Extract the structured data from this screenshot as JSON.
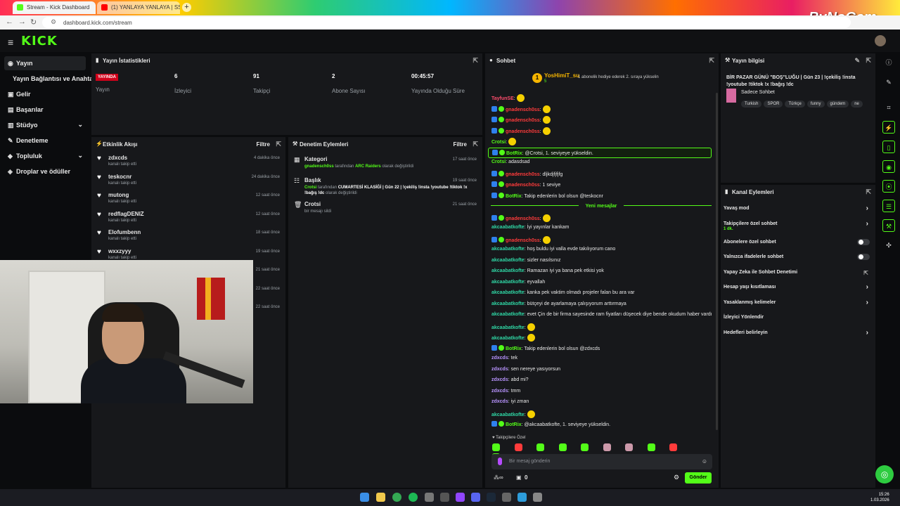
{
  "browser": {
    "tabs": [
      {
        "title": "Stream - Kick Dashboard"
      },
      {
        "title": "(1) YANLAYA YANLAYA | SS/dc"
      }
    ],
    "url": "dashboard.kick.com/stream",
    "watermark": "ByNoGam"
  },
  "brand": {
    "logo": "KICK",
    "accent": "#53fc18"
  },
  "sidebar": {
    "items": [
      {
        "label": "Yayın",
        "icon": "broadcast-icon"
      },
      {
        "label": "Yayın Bağlantısı ve Anahtarı",
        "icon": ""
      },
      {
        "label": "Gelir",
        "icon": "income-icon"
      },
      {
        "label": "Başarılar",
        "icon": "achievements-icon"
      },
      {
        "label": "Stüdyo",
        "icon": "studio-icon"
      },
      {
        "label": "Denetleme",
        "icon": "moderation-icon"
      },
      {
        "label": "Topluluk",
        "icon": "community-icon"
      },
      {
        "label": "Droplar ve ödüller",
        "icon": "drops-icon"
      }
    ]
  },
  "stats": {
    "title": "Yayın İstatistikleri",
    "live_badge": "YAYINDA",
    "items": [
      {
        "value": "",
        "label": "Yayın"
      },
      {
        "value": "6",
        "label": "İzleyici"
      },
      {
        "value": "91",
        "label": "Takipçi"
      },
      {
        "value": "2",
        "label": "Abone Sayısı"
      },
      {
        "value": "00:45:57",
        "label": "Yayında Olduğu Süre"
      }
    ]
  },
  "activity": {
    "title": "Etkinlik Akışı",
    "filter": "Filtre",
    "rows": [
      {
        "name": "zdxcds",
        "sub": "kanalı takip etti",
        "time": "4 dakika önce"
      },
      {
        "name": "teskocnr",
        "sub": "kanalı takip etti",
        "time": "24 dakika önce"
      },
      {
        "name": "mutong",
        "sub": "kanalı takip etti",
        "time": "12 saat önce"
      },
      {
        "name": "redflagDENIZ",
        "sub": "kanalı takip etti",
        "time": "12 saat önce"
      },
      {
        "name": "Elofumbenn",
        "sub": "kanalı takip etti",
        "time": "18 saat önce"
      },
      {
        "name": "wxxzyyy",
        "sub": "kanalı takip etti",
        "time": "19 saat önce"
      },
      {
        "name": "",
        "sub": "",
        "time": "21 saat önce"
      },
      {
        "name": "",
        "sub": "",
        "time": "22 saat önce"
      },
      {
        "name": "",
        "sub": "",
        "time": "22 saat önce"
      }
    ]
  },
  "moderation": {
    "title": "Denetim Eylemleri",
    "filter": "Filtre",
    "rows": [
      {
        "name": "Kategori",
        "actor": "gnadensch0ss",
        "pre": "tarafından",
        "value": "ARC Raiders",
        "post": "olarak değiştirildi",
        "time": "17 saat önce",
        "icon": "category-icon"
      },
      {
        "name": "Başlık",
        "actor": "Crotsi",
        "pre": "tarafından",
        "value": "CUMARTESİ KLASİĞİ | Gün 22 | !çekiliş !insta !youtube !tiktok !x !bağış !dc",
        "post": "olarak değiştirildi",
        "time": "19 saat önce",
        "icon": "title-icon"
      },
      {
        "name": "Crotsi",
        "actor": "",
        "pre": "",
        "value": "",
        "post": "bir mesajı sildi",
        "time": "21 saat önce",
        "icon": "trash-icon"
      }
    ]
  },
  "chat": {
    "title": "Sohbet",
    "pinned": {
      "user": "YosHimiT_su",
      "count": "5",
      "message": "1 abonelik hediye ederek 2. sıraya yükselin"
    },
    "messages": [
      {
        "user": "TayfunSE",
        "text": "",
        "color": "#ff4d6d",
        "emote": true
      },
      {
        "user": "gnadensch0ss",
        "text": "",
        "color": "#ff3b3b",
        "emote": true,
        "badge": true
      },
      {
        "user": "gnadensch0ss",
        "text": "",
        "color": "#ff3b3b",
        "emote": true,
        "badge": true
      },
      {
        "user": "gnadensch0ss",
        "text": "",
        "color": "#ff3b3b",
        "emote": true,
        "badge": true
      },
      {
        "user": "Crotsi",
        "text": "",
        "color": "#53fc18",
        "emote": true
      },
      {
        "user": "BotRix",
        "text": ": @Crotsi, 1. seviyeye yükseldin.",
        "color": "#53fc18",
        "hl": true,
        "badge": true
      },
      {
        "user": "Crotsi",
        "text": ": adasdsad",
        "color": "#53fc18"
      },
      {
        "user": "gnadensch0ss",
        "text": ": dljkdjfjfjfg",
        "color": "#ff3b3b",
        "badge": true
      },
      {
        "user": "gnadensch0ss",
        "text": ": 1 seviye",
        "color": "#ff3b3b",
        "badge": true
      },
      {
        "user": "BotRix",
        "text": ": Takip edenlerin bol olsun @teskocnr",
        "color": "#53fc18",
        "badge": true
      },
      {
        "newmsg": "Yeni mesajlar"
      },
      {
        "user": "gnadensch0ss",
        "text": "",
        "color": "#ff3b3b",
        "emote": true,
        "badge": true
      },
      {
        "user": "akcaabatkofte",
        "text": ": İyi yayınlar kankam",
        "color": "#2fd7a5"
      },
      {
        "user": "gnadensch0ss",
        "text": "",
        "color": "#ff3b3b",
        "emote": true,
        "badge": true
      },
      {
        "user": "akcaabatkofte",
        "text": ": hoş buldu iyi valla evde takılıyorum cano",
        "color": "#2fd7a5"
      },
      {
        "user": "akcaabatkofte",
        "text": ": sizler nasılsınız",
        "color": "#2fd7a5"
      },
      {
        "user": "akcaabatkofte",
        "text": ": Ramazan iyi ya bana pek etkisi yok",
        "color": "#2fd7a5"
      },
      {
        "user": "akcaabatkofte",
        "text": ": eyvallah",
        "color": "#2fd7a5"
      },
      {
        "user": "akcaabatkofte",
        "text": ": kanka pek vaktim olmadı projeler falan bu ara var",
        "color": "#2fd7a5"
      },
      {
        "user": "akcaabatkofte",
        "text": ": bütçeyi de ayarlamaya çalışıyorum arttırmaya",
        "color": "#2fd7a5"
      },
      {
        "user": "akcaabatkofte",
        "text": ": evet Çin de bir firma sayesinde ram fiyatları düşecek diye bende okudum haber vardı",
        "color": "#2fd7a5"
      },
      {
        "user": "akcaabatkofte",
        "text": "",
        "color": "#2fd7a5",
        "emote": true
      },
      {
        "user": "akcaabatkofte",
        "text": "",
        "color": "#2fd7a5",
        "emote": true
      },
      {
        "user": "BotRix",
        "text": ": Takip edenlerin bol olsun @zdxcds",
        "color": "#53fc18",
        "badge": true
      },
      {
        "user": "zdxcds",
        "text": ": tek",
        "color": "#b994ff"
      },
      {
        "user": "zdxcds",
        "text": ": sen nereye yasıyorsun",
        "color": "#b994ff"
      },
      {
        "user": "zdxcds",
        "text": ": abd mi?",
        "color": "#b994ff"
      },
      {
        "user": "zdxcds",
        "text": ": tmm",
        "color": "#b994ff"
      },
      {
        "user": "zdxcds",
        "text": ": iyi zman",
        "color": "#b994ff"
      },
      {
        "user": "akcaabatkofte",
        "text": "",
        "color": "#2fd7a5",
        "emote": true
      },
      {
        "user": "BotRix",
        "text": ": @akcaabatkofte, 1. seviyeye yükseldin.",
        "color": "#53fc18",
        "badge": true
      }
    ],
    "sub_only_label": "Takipçilere Özel",
    "input_placeholder": "Bir mesaj gönderin",
    "points": "0",
    "send_label": "Gönder"
  },
  "stream_info": {
    "title": "Yayın bilgisi",
    "stream_title": "BİR PAZAR GÜNÜ \"BOŞ\"LUĞU | Gün 23 | !çekiliş !insta !youtube !tiktok !x !bağış !dc",
    "category": "Sadece Sohbet",
    "tags": [
      "Turkish",
      "SPOR",
      "Türkçe",
      "funny",
      "gündem",
      "ne"
    ]
  },
  "channel_actions": {
    "title": "Kanal Eylemleri",
    "items": [
      {
        "label": "Yavaş mod",
        "kind": "arrow"
      },
      {
        "label": "Takipçilere özel sohbet",
        "sub": "1 dk.",
        "kind": "arrow"
      },
      {
        "label": "Abonelere özel sohbet",
        "kind": "toggle"
      },
      {
        "label": "Yalnızca ifadelerle sohbet",
        "kind": "toggle"
      },
      {
        "label": "Yapay Zeka ile Sohbet Denetimi",
        "kind": "ext"
      },
      {
        "label": "Hesap yaşı kısıtlaması",
        "kind": "arrow"
      },
      {
        "label": "Yasaklanmış kelimeler",
        "kind": "arrow"
      },
      {
        "label": "İzleyici Yönlendir",
        "kind": "none"
      },
      {
        "label": "Hedefleri belirleyin",
        "kind": "arrow"
      }
    ]
  },
  "taskbar": {
    "time": "15:26",
    "date": "1.03.2026"
  }
}
